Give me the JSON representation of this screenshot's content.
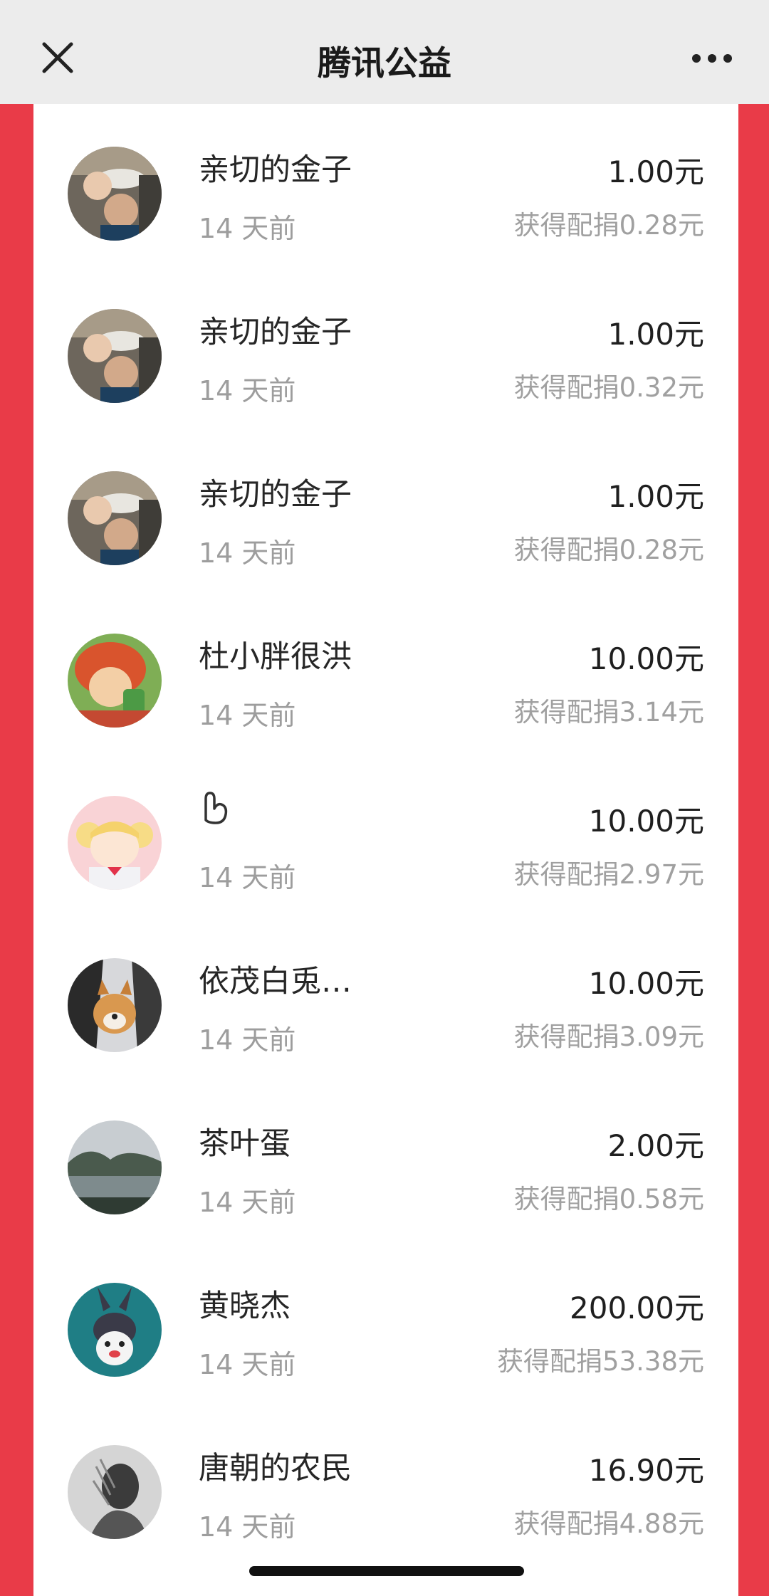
{
  "header": {
    "title": "腾讯公益",
    "close_icon": "close-icon",
    "more_icon": "more-icon"
  },
  "donations": [
    {
      "avatar": "avatar-child-photo",
      "name": "亲切的金子",
      "time": "14 天前",
      "amount": "1.00元",
      "match": "获得配捐0.28元"
    },
    {
      "avatar": "avatar-child-photo",
      "name": "亲切的金子",
      "time": "14 天前",
      "amount": "1.00元",
      "match": "获得配捐0.32元"
    },
    {
      "avatar": "avatar-child-photo",
      "name": "亲切的金子",
      "time": "14 天前",
      "amount": "1.00元",
      "match": "获得配捐0.28元"
    },
    {
      "avatar": "avatar-cartoon-redhair",
      "name": "杜小胖很洪",
      "time": "14 天前",
      "amount": "10.00元",
      "match": "获得配捐3.14元"
    },
    {
      "avatar": "avatar-anime-girl",
      "name": "",
      "time": "14 天前",
      "amount": "10.00元",
      "match": "获得配捐2.97元"
    },
    {
      "avatar": "avatar-shiba-dog",
      "name": "依茂白兎…",
      "time": "14 天前",
      "amount": "10.00元",
      "match": "获得配捐3.09元"
    },
    {
      "avatar": "avatar-lake-landscape",
      "name": "茶叶蛋",
      "time": "14 天前",
      "amount": "2.00元",
      "match": "获得配捐0.58元"
    },
    {
      "avatar": "avatar-cartoon-rabbit",
      "name": "黄晓杰",
      "time": "14 天前",
      "amount": "200.00元",
      "match": "获得配捐53.38元"
    },
    {
      "avatar": "avatar-bw-portrait",
      "name": "唐朝的农民",
      "time": "14 天前",
      "amount": "16.90元",
      "match": "获得配捐4.88元"
    }
  ],
  "colors": {
    "accent_red": "#e93b48",
    "header_bg": "#ececec",
    "text_primary": "#262626",
    "text_secondary": "#a0a0a0"
  }
}
